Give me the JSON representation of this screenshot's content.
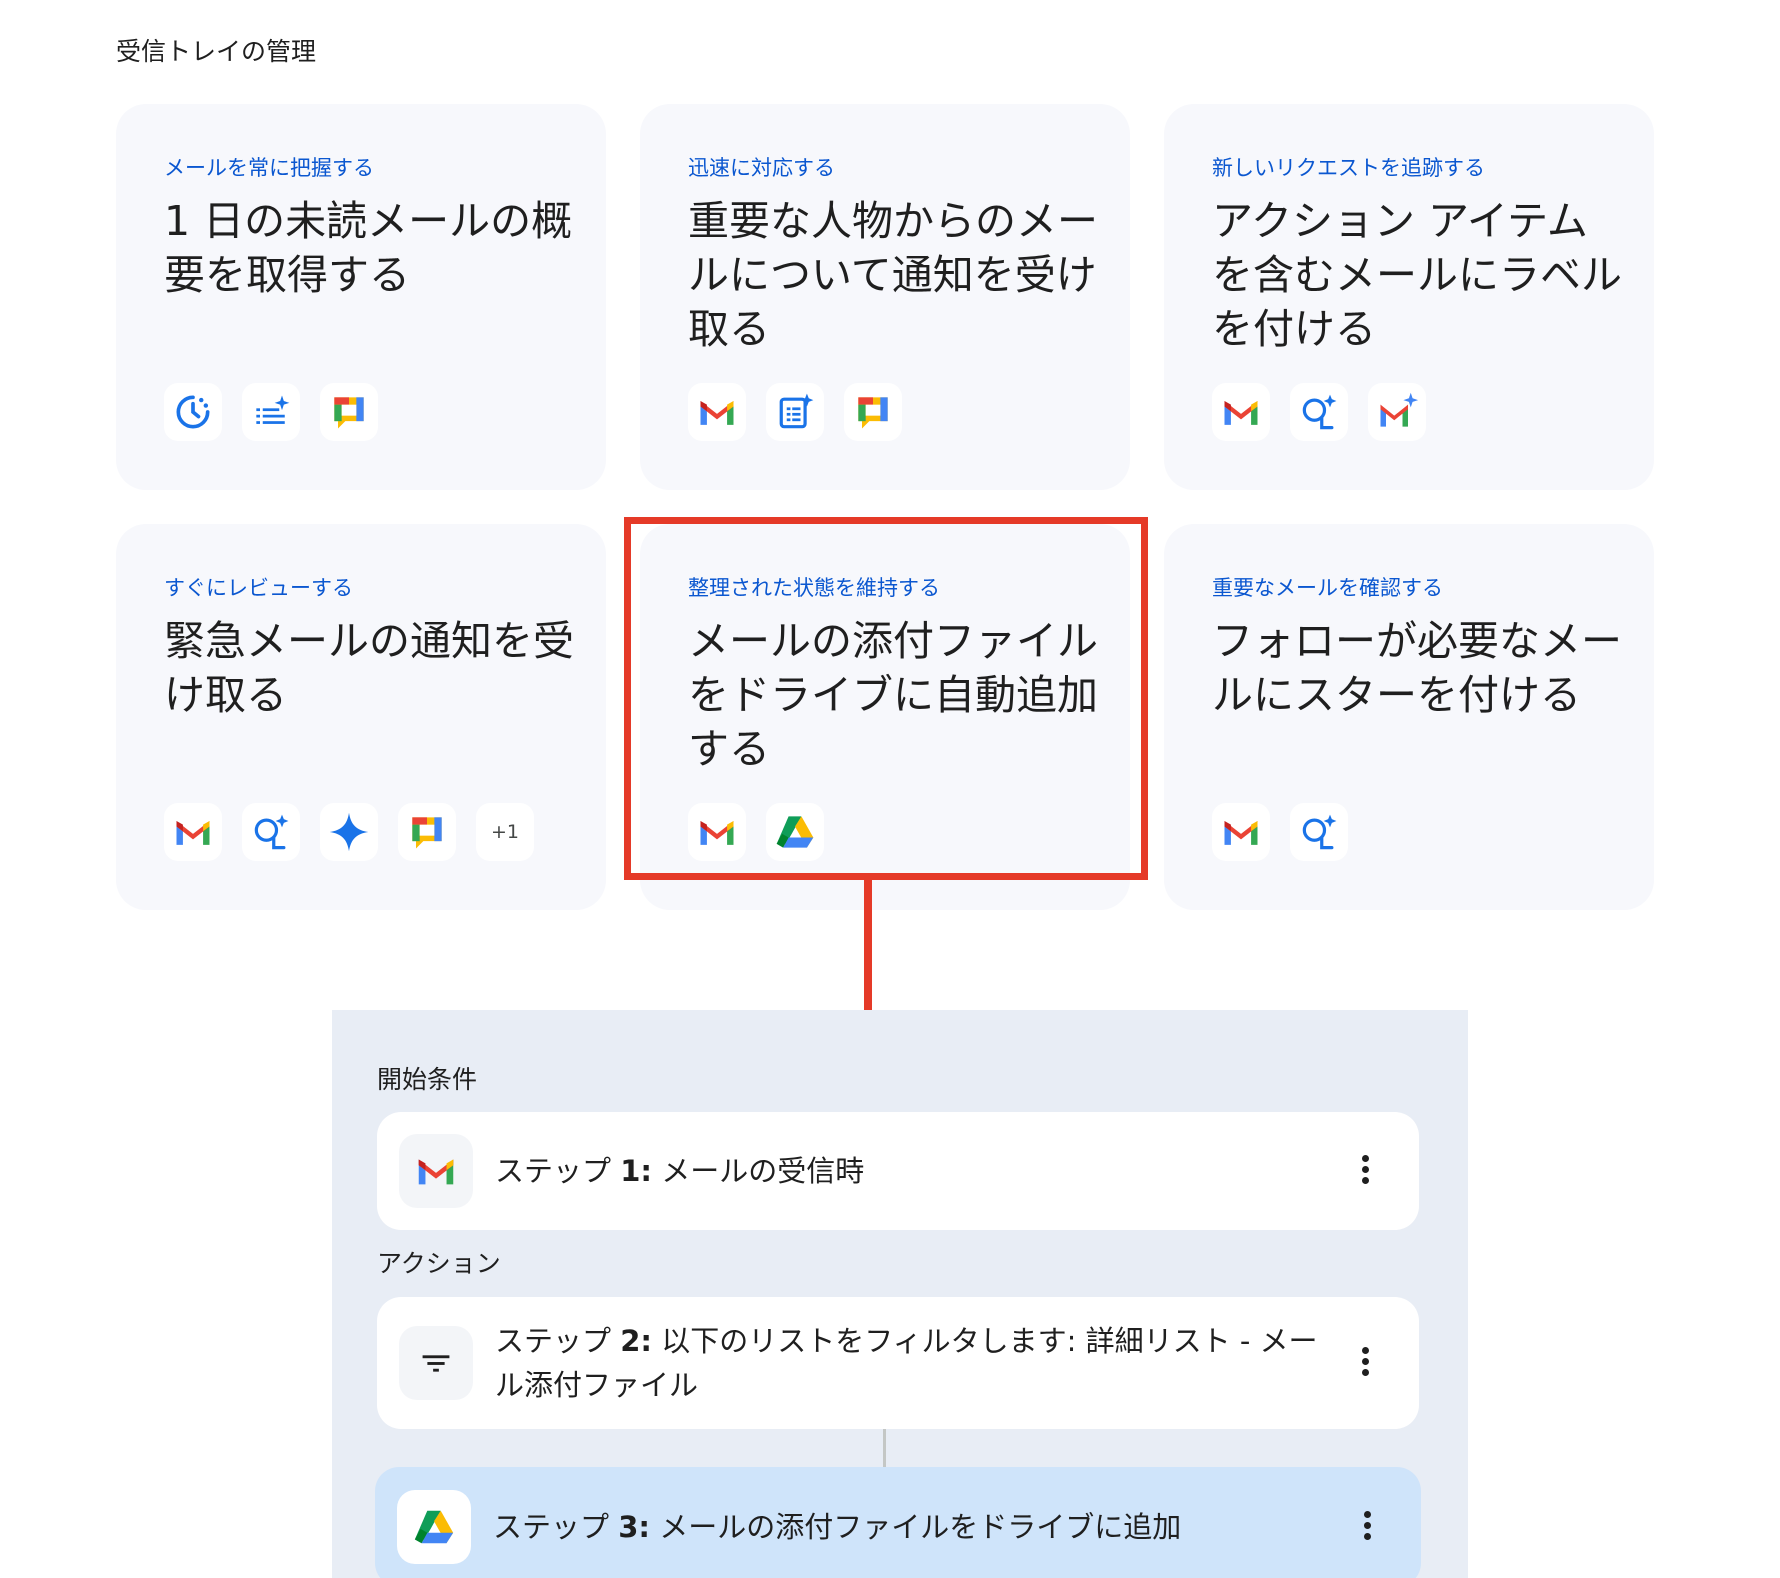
{
  "section": {
    "title": "受信トレイの管理"
  },
  "cards": [
    {
      "kicker": "メールを常に把握する",
      "title": "1 日の未読メールの概要を取得する",
      "icons": [
        "clock-sparkle-icon",
        "list-sparkle-icon",
        "google-chat-icon"
      ],
      "extra": ""
    },
    {
      "kicker": "迅速に対応する",
      "title": "重要な人物からのメールについて通知を受け取る",
      "icons": [
        "gmail-icon",
        "doc-sparkle-icon",
        "google-chat-icon"
      ],
      "extra": ""
    },
    {
      "kicker": "新しいリクエストを追跡する",
      "title": "アクション アイテムを含むメールにラベルを付ける",
      "icons": [
        "gmail-icon",
        "ask-gemini-icon",
        "gmail-sparkle-icon"
      ],
      "extra": ""
    },
    {
      "kicker": "すぐにレビューする",
      "title": "緊急メールの通知を受け取る",
      "icons": [
        "gmail-icon",
        "ask-gemini-icon",
        "gemini-spark-icon",
        "google-chat-icon"
      ],
      "extra": "+1"
    },
    {
      "kicker": "整理された状態を維持する",
      "title": "メールの添付ファイルをドライブに自動追加する",
      "icons": [
        "gmail-icon",
        "google-drive-icon"
      ],
      "extra": ""
    },
    {
      "kicker": "重要なメールを確認する",
      "title": "フォローが必要なメールにスターを付ける",
      "icons": [
        "gmail-icon",
        "ask-gemini-icon"
      ],
      "extra": ""
    }
  ],
  "annotation": {
    "highlight_color": "#e53a28",
    "highlighted_card": "整理された状態を維持する"
  },
  "flow": {
    "starter_label": "開始条件",
    "actions_label": "アクション",
    "steps": [
      {
        "prefix": "ステップ ",
        "number": "1:",
        "text": " メールの受信時",
        "icon": "gmail-icon"
      },
      {
        "prefix": "ステップ ",
        "number": "2:",
        "text": " 以下のリストをフィルタします: 詳細リスト - メール添付ファイル",
        "icon": "filter-icon"
      },
      {
        "prefix": "ステップ ",
        "number": "3:",
        "text": " メールの添付ファイルをドライブに追加",
        "icon": "google-drive-icon"
      }
    ]
  },
  "colors": {
    "card_bg": "#f7f8fc",
    "kicker": "#0b57d0",
    "panel_bg": "#e8edf5",
    "active_step_bg": "#cfe4fa",
    "google_blue": "#4285f4",
    "google_red": "#ea4335",
    "google_yellow": "#fbbc04",
    "google_green": "#34a853"
  }
}
